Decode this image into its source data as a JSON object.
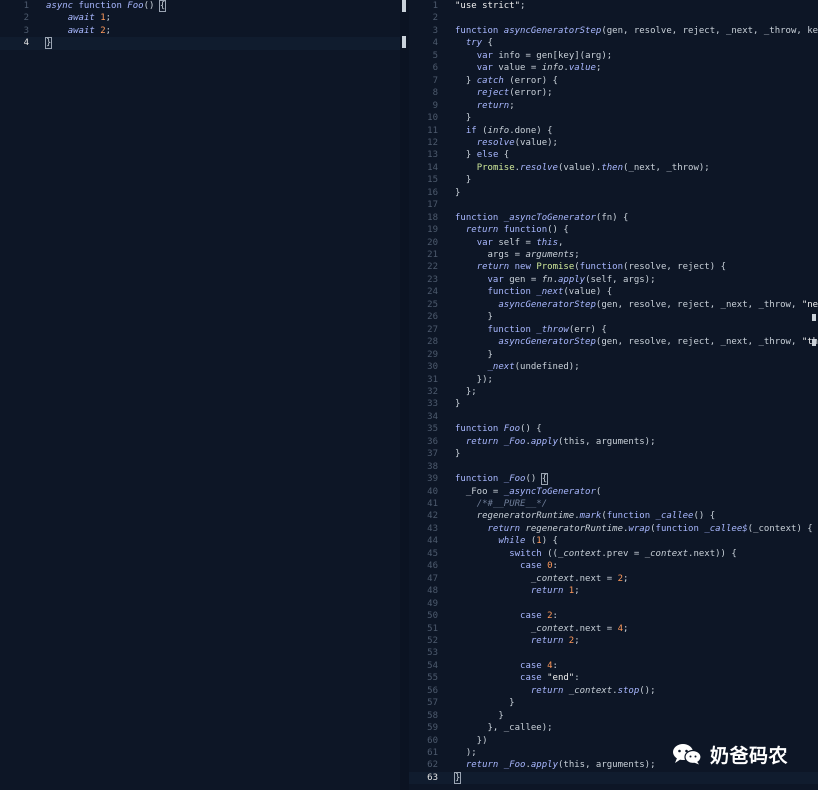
{
  "left_editor": {
    "current_line": 4,
    "lines": [
      {
        "n": "1",
        "tokens": [
          [
            "kw it",
            "async "
          ],
          [
            "kw",
            "function "
          ],
          [
            "fn",
            "Foo"
          ],
          [
            "pn",
            "() "
          ],
          [
            "pn bracket",
            "{"
          ]
        ]
      },
      {
        "n": "2",
        "tokens": [
          [
            "pn",
            "    "
          ],
          [
            "kw it",
            "await "
          ],
          [
            "num",
            "1"
          ],
          [
            "pn",
            ";"
          ]
        ]
      },
      {
        "n": "3",
        "tokens": [
          [
            "pn",
            "    "
          ],
          [
            "kw it",
            "await "
          ],
          [
            "num",
            "2"
          ],
          [
            "pn",
            ";"
          ]
        ]
      },
      {
        "n": "4",
        "tokens": [
          [
            "pn bracket",
            "}"
          ]
        ]
      }
    ]
  },
  "right_editor": {
    "current_line": 63,
    "lines": [
      {
        "n": "1",
        "tokens": [
          [
            "str",
            "\"use strict\""
          ],
          [
            "pn",
            ";"
          ]
        ]
      },
      {
        "n": "2",
        "tokens": []
      },
      {
        "n": "3",
        "tokens": [
          [
            "kw",
            "function "
          ],
          [
            "fn",
            "asyncGeneratorStep"
          ],
          [
            "pn",
            "(gen, resolve, reject, _next, _throw, key, arg) {"
          ]
        ]
      },
      {
        "n": "4",
        "tokens": [
          [
            "pn",
            "  "
          ],
          [
            "kw it",
            "try"
          ],
          [
            "pn",
            " {"
          ]
        ]
      },
      {
        "n": "5",
        "tokens": [
          [
            "pn",
            "    "
          ],
          [
            "kw",
            "var "
          ],
          [
            "pn",
            "info = gen[key](arg);"
          ]
        ]
      },
      {
        "n": "6",
        "tokens": [
          [
            "pn",
            "    "
          ],
          [
            "kw",
            "var "
          ],
          [
            "pn",
            "value = "
          ],
          [
            "it",
            "info"
          ],
          [
            "pn",
            "."
          ],
          [
            "fn",
            "value"
          ],
          [
            "pn",
            ";"
          ]
        ]
      },
      {
        "n": "7",
        "tokens": [
          [
            "pn",
            "  } "
          ],
          [
            "kw it",
            "catch"
          ],
          [
            "pn",
            " (error) {"
          ]
        ]
      },
      {
        "n": "8",
        "tokens": [
          [
            "pn",
            "    "
          ],
          [
            "fn",
            "reject"
          ],
          [
            "pn",
            "(error);"
          ]
        ]
      },
      {
        "n": "9",
        "tokens": [
          [
            "pn",
            "    "
          ],
          [
            "kw it",
            "return"
          ],
          [
            "pn",
            ";"
          ]
        ]
      },
      {
        "n": "10",
        "tokens": [
          [
            "pn",
            "  }"
          ]
        ]
      },
      {
        "n": "11",
        "tokens": [
          [
            "pn",
            "  "
          ],
          [
            "kw",
            "if"
          ],
          [
            "pn",
            " ("
          ],
          [
            "it",
            "info"
          ],
          [
            "pn",
            ".done) {"
          ]
        ]
      },
      {
        "n": "12",
        "tokens": [
          [
            "pn",
            "    "
          ],
          [
            "fn",
            "resolve"
          ],
          [
            "pn",
            "(value);"
          ]
        ]
      },
      {
        "n": "13",
        "tokens": [
          [
            "pn",
            "  } "
          ],
          [
            "kw",
            "else"
          ],
          [
            "pn",
            " {"
          ]
        ]
      },
      {
        "n": "14",
        "tokens": [
          [
            "pn",
            "    "
          ],
          [
            "cls",
            "Promise"
          ],
          [
            "pn",
            "."
          ],
          [
            "fn",
            "resolve"
          ],
          [
            "pn",
            "(value)."
          ],
          [
            "fn",
            "then"
          ],
          [
            "pn",
            "(_next, _throw);"
          ]
        ]
      },
      {
        "n": "15",
        "tokens": [
          [
            "pn",
            "  }"
          ]
        ]
      },
      {
        "n": "16",
        "tokens": [
          [
            "pn",
            "}"
          ]
        ]
      },
      {
        "n": "17",
        "tokens": []
      },
      {
        "n": "18",
        "tokens": [
          [
            "kw",
            "function "
          ],
          [
            "fn",
            "_asyncToGenerator"
          ],
          [
            "pn",
            "(fn) {"
          ]
        ]
      },
      {
        "n": "19",
        "tokens": [
          [
            "pn",
            "  "
          ],
          [
            "kw it",
            "return "
          ],
          [
            "kw",
            "function"
          ],
          [
            "pn",
            "() {"
          ]
        ]
      },
      {
        "n": "20",
        "tokens": [
          [
            "pn",
            "    "
          ],
          [
            "kw",
            "var "
          ],
          [
            "pn",
            "self = "
          ],
          [
            "kw it",
            "this"
          ],
          [
            "pn",
            ","
          ]
        ]
      },
      {
        "n": "21",
        "tokens": [
          [
            "pn",
            "      args = "
          ],
          [
            "it",
            "arguments"
          ],
          [
            "pn",
            ";"
          ]
        ]
      },
      {
        "n": "22",
        "tokens": [
          [
            "pn",
            "    "
          ],
          [
            "kw it",
            "return "
          ],
          [
            "kw",
            "new "
          ],
          [
            "cls",
            "Promise"
          ],
          [
            "pn",
            "("
          ],
          [
            "kw",
            "function"
          ],
          [
            "pn",
            "(resolve, reject) {"
          ]
        ]
      },
      {
        "n": "23",
        "tokens": [
          [
            "pn",
            "      "
          ],
          [
            "kw",
            "var "
          ],
          [
            "pn",
            "gen = "
          ],
          [
            "it",
            "fn"
          ],
          [
            "pn",
            "."
          ],
          [
            "fn",
            "apply"
          ],
          [
            "pn",
            "(self, args);"
          ]
        ]
      },
      {
        "n": "24",
        "tokens": [
          [
            "pn",
            "      "
          ],
          [
            "kw",
            "function "
          ],
          [
            "fn",
            "_next"
          ],
          [
            "pn",
            "(value) {"
          ]
        ]
      },
      {
        "n": "25",
        "tokens": [
          [
            "pn",
            "        "
          ],
          [
            "fn",
            "asyncGeneratorStep"
          ],
          [
            "pn",
            "(gen, resolve, reject, _next, _throw, "
          ],
          [
            "str",
            "\"next\""
          ],
          [
            "pn",
            ", value);"
          ]
        ]
      },
      {
        "n": "26",
        "tokens": [
          [
            "pn",
            "      }"
          ]
        ]
      },
      {
        "n": "27",
        "tokens": [
          [
            "pn",
            "      "
          ],
          [
            "kw",
            "function "
          ],
          [
            "fn",
            "_throw"
          ],
          [
            "pn",
            "(err) {"
          ]
        ]
      },
      {
        "n": "28",
        "tokens": [
          [
            "pn",
            "        "
          ],
          [
            "fn",
            "asyncGeneratorStep"
          ],
          [
            "pn",
            "(gen, resolve, reject, _next, _throw, "
          ],
          [
            "str",
            "\"throw\""
          ],
          [
            "pn",
            ", err);"
          ]
        ]
      },
      {
        "n": "29",
        "tokens": [
          [
            "pn",
            "      }"
          ]
        ]
      },
      {
        "n": "30",
        "tokens": [
          [
            "pn",
            "      "
          ],
          [
            "fn",
            "_next"
          ],
          [
            "pn",
            "(undefined);"
          ]
        ]
      },
      {
        "n": "31",
        "tokens": [
          [
            "pn",
            "    });"
          ]
        ]
      },
      {
        "n": "32",
        "tokens": [
          [
            "pn",
            "  };"
          ]
        ]
      },
      {
        "n": "33",
        "tokens": [
          [
            "pn",
            "}"
          ]
        ]
      },
      {
        "n": "34",
        "tokens": []
      },
      {
        "n": "35",
        "tokens": [
          [
            "kw",
            "function "
          ],
          [
            "fn",
            "Foo"
          ],
          [
            "pn",
            "() {"
          ]
        ]
      },
      {
        "n": "36",
        "tokens": [
          [
            "pn",
            "  "
          ],
          [
            "kw it",
            "return "
          ],
          [
            "fn",
            "_Foo"
          ],
          [
            "pn",
            "."
          ],
          [
            "fn",
            "apply"
          ],
          [
            "pn",
            "(this, arguments);"
          ]
        ]
      },
      {
        "n": "37",
        "tokens": [
          [
            "pn",
            "}"
          ]
        ]
      },
      {
        "n": "38",
        "tokens": []
      },
      {
        "n": "39",
        "tokens": [
          [
            "kw",
            "function "
          ],
          [
            "fn",
            "_Foo"
          ],
          [
            "pn",
            "() "
          ],
          [
            "pn bracket",
            "{"
          ]
        ]
      },
      {
        "n": "40",
        "tokens": [
          [
            "pn",
            "  _Foo = "
          ],
          [
            "fn",
            "_asyncToGenerator"
          ],
          [
            "pn",
            "("
          ]
        ]
      },
      {
        "n": "41",
        "tokens": [
          [
            "pn",
            "    "
          ],
          [
            "cm",
            "/*#__PURE__*/"
          ]
        ]
      },
      {
        "n": "42",
        "tokens": [
          [
            "pn",
            "    "
          ],
          [
            "it",
            "regeneratorRuntime"
          ],
          [
            "pn",
            "."
          ],
          [
            "fn",
            "mark"
          ],
          [
            "pn",
            "("
          ],
          [
            "kw",
            "function "
          ],
          [
            "fn",
            "_callee"
          ],
          [
            "pn",
            "() {"
          ]
        ]
      },
      {
        "n": "43",
        "tokens": [
          [
            "pn",
            "      "
          ],
          [
            "kw it",
            "return "
          ],
          [
            "it",
            "regeneratorRuntime"
          ],
          [
            "pn",
            "."
          ],
          [
            "fn",
            "wrap"
          ],
          [
            "pn",
            "("
          ],
          [
            "kw",
            "function "
          ],
          [
            "fn",
            "_callee$"
          ],
          [
            "pn",
            "(_context) {"
          ]
        ]
      },
      {
        "n": "44",
        "tokens": [
          [
            "pn",
            "        "
          ],
          [
            "kw it",
            "while"
          ],
          [
            "pn",
            " ("
          ],
          [
            "num",
            "1"
          ],
          [
            "pn",
            ") {"
          ]
        ]
      },
      {
        "n": "45",
        "tokens": [
          [
            "pn",
            "          "
          ],
          [
            "kw",
            "switch"
          ],
          [
            "pn",
            " (("
          ],
          [
            "it",
            "_context"
          ],
          [
            "pn",
            ".prev = "
          ],
          [
            "it",
            "_context"
          ],
          [
            "pn",
            ".next)) {"
          ]
        ]
      },
      {
        "n": "46",
        "tokens": [
          [
            "pn",
            "            "
          ],
          [
            "kw",
            "case "
          ],
          [
            "num",
            "0"
          ],
          [
            "pn",
            ":"
          ]
        ]
      },
      {
        "n": "47",
        "tokens": [
          [
            "pn",
            "              "
          ],
          [
            "it",
            "_context"
          ],
          [
            "pn",
            ".next = "
          ],
          [
            "num",
            "2"
          ],
          [
            "pn",
            ";"
          ]
        ]
      },
      {
        "n": "48",
        "tokens": [
          [
            "pn",
            "              "
          ],
          [
            "kw it",
            "return "
          ],
          [
            "num",
            "1"
          ],
          [
            "pn",
            ";"
          ]
        ]
      },
      {
        "n": "49",
        "tokens": []
      },
      {
        "n": "50",
        "tokens": [
          [
            "pn",
            "            "
          ],
          [
            "kw",
            "case "
          ],
          [
            "num",
            "2"
          ],
          [
            "pn",
            ":"
          ]
        ]
      },
      {
        "n": "51",
        "tokens": [
          [
            "pn",
            "              "
          ],
          [
            "it",
            "_context"
          ],
          [
            "pn",
            ".next = "
          ],
          [
            "num",
            "4"
          ],
          [
            "pn",
            ";"
          ]
        ]
      },
      {
        "n": "52",
        "tokens": [
          [
            "pn",
            "              "
          ],
          [
            "kw it",
            "return "
          ],
          [
            "num",
            "2"
          ],
          [
            "pn",
            ";"
          ]
        ]
      },
      {
        "n": "53",
        "tokens": []
      },
      {
        "n": "54",
        "tokens": [
          [
            "pn",
            "            "
          ],
          [
            "kw",
            "case "
          ],
          [
            "num",
            "4"
          ],
          [
            "pn",
            ":"
          ]
        ]
      },
      {
        "n": "55",
        "tokens": [
          [
            "pn",
            "            "
          ],
          [
            "kw",
            "case "
          ],
          [
            "str",
            "\"end\""
          ],
          [
            "pn",
            ":"
          ]
        ]
      },
      {
        "n": "56",
        "tokens": [
          [
            "pn",
            "              "
          ],
          [
            "kw it",
            "return "
          ],
          [
            "it",
            "_context"
          ],
          [
            "pn",
            "."
          ],
          [
            "fn",
            "stop"
          ],
          [
            "pn",
            "();"
          ]
        ]
      },
      {
        "n": "57",
        "tokens": [
          [
            "pn",
            "          }"
          ]
        ]
      },
      {
        "n": "58",
        "tokens": [
          [
            "pn",
            "        }"
          ]
        ]
      },
      {
        "n": "59",
        "tokens": [
          [
            "pn",
            "      }, _callee);"
          ]
        ]
      },
      {
        "n": "60",
        "tokens": [
          [
            "pn",
            "    })"
          ]
        ]
      },
      {
        "n": "61",
        "tokens": [
          [
            "pn",
            "  );"
          ]
        ]
      },
      {
        "n": "62",
        "tokens": [
          [
            "pn",
            "  "
          ],
          [
            "kw it",
            "return "
          ],
          [
            "fn",
            "_Foo"
          ],
          [
            "pn",
            "."
          ],
          [
            "fn",
            "apply"
          ],
          [
            "pn",
            "(this, arguments);"
          ]
        ]
      },
      {
        "n": "63",
        "tokens": [
          [
            "pn bracket",
            "}"
          ]
        ]
      }
    ]
  },
  "watermark": {
    "icon": "wechat-icon",
    "text": "奶爸码农"
  },
  "colors": {
    "background": "#0d1626",
    "keyword": "#a9b8ff",
    "string": "#f0f0f0",
    "number": "#ff9a5c",
    "comment": "#6f7e99",
    "class": "#cfe89a",
    "gutter": "#4d5a6d"
  }
}
